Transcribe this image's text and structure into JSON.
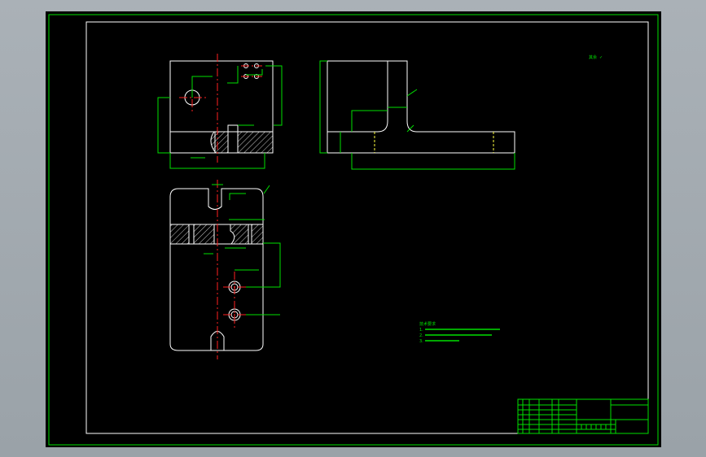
{
  "drawing": {
    "roughness_mark": "其余",
    "roughness_symbol": "✓",
    "title_block": {
      "name_label": "",
      "drawing_number": "",
      "scale_text": ""
    },
    "tech_notes": [
      "技术要求",
      "1.",
      "2.",
      "3."
    ]
  },
  "colors": {
    "background": "#000000",
    "frame": "#00e000",
    "outline": "#ffffff",
    "centerline": "#ff2020",
    "hidden": "#ffff40"
  }
}
